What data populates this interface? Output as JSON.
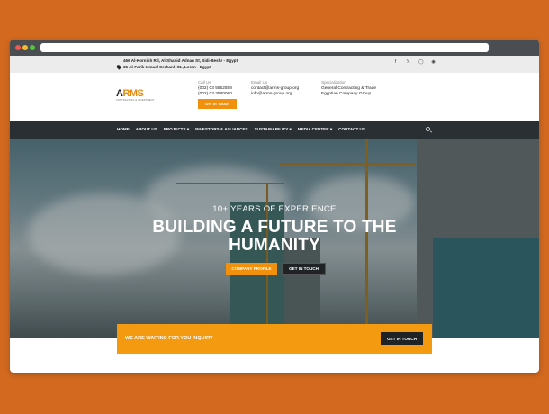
{
  "topbar": {
    "address_1": "466 Al-Kornish Rd, Al-Shahid Adnan St, Sidi-Beshr - Egypt",
    "address_2": "35 Al-Farik Ismael Serhank St., Loran - Egypt",
    "social_icons": [
      "facebook-icon",
      "twitter-icon",
      "instagram-icon",
      "github-icon"
    ]
  },
  "header": {
    "logo_text_a": "A",
    "logo_text_b": "RMS",
    "logo_tagline": "CONTRACTING & INVESTMENT",
    "call": {
      "label": "Call Us",
      "phone_1": "(002) 03 5852558",
      "phone_2": "(002) 03 3580060"
    },
    "email": {
      "label": "Email Us",
      "email_1": "contact@arms-group.org",
      "email_2": "info@arms-group.org"
    },
    "specialization": {
      "label": "Specialization",
      "line_1": "General Contracting & Trade",
      "line_2": "Egyptian Company Group"
    },
    "cta_label": "Get In Touch"
  },
  "nav": {
    "items": [
      "HOME",
      "ABOUT US",
      "PROJECTS ▾",
      "INVESTORS & ALLIANCES",
      "SUSTAINABILITY ▾",
      "MEDIA CENTER ▾",
      "CONTACT US"
    ]
  },
  "hero": {
    "experience": "10+ YEARS OF EXPERIENCE",
    "headline_1": "BUILDING A FUTURE TO THE",
    "headline_2": "HUMANITY",
    "btn_profile": "COMPANY PROFILE",
    "btn_touch": "GET IN TOUCH"
  },
  "inquiry": {
    "text": "WE ARE WAITING FOR YOU INQUIRY",
    "button": "GET IN TOUCH"
  },
  "colors": {
    "page_bg": "#d2691f",
    "accent": "#f0900c",
    "nav_bg": "#2a2f34",
    "dark_button": "#1f2326"
  }
}
